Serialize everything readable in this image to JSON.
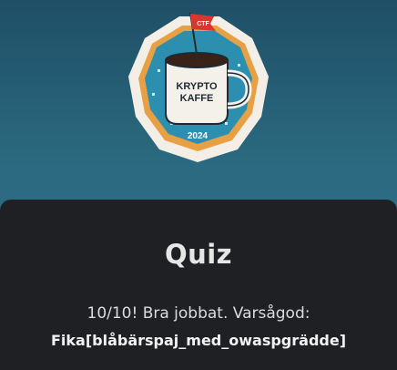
{
  "logo": {
    "flag_text": "CTF",
    "mug_line1": "KRYPTO",
    "mug_line2": "KAFFE",
    "year": "2024"
  },
  "quiz": {
    "title": "Quiz",
    "message": "10/10! Bra jobbat. Varsågod:",
    "flag": "Fika[blåbärspaj_med_owaspgrädde]"
  }
}
